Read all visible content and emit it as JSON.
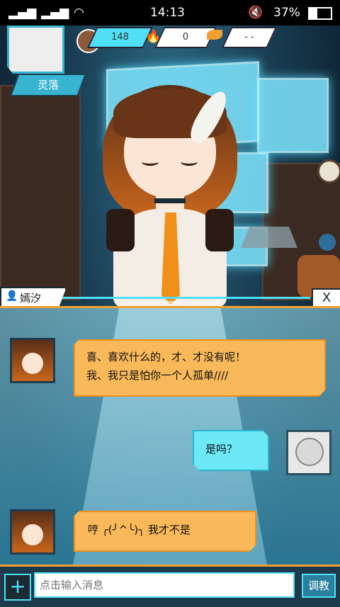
{
  "status_bar": {
    "time": "14:13",
    "battery_percent": "37%",
    "signal_1_label": "1",
    "signal_2_label": "2"
  },
  "hud": {
    "player_name": "灵落",
    "resource_1": "148",
    "resource_2": "0",
    "resource_3": "- -"
  },
  "speaker": {
    "name": "嫣汐",
    "close_label": "X"
  },
  "messages": [
    {
      "sender": "character",
      "text_line_1": "喜、喜欢什么的，才、才没有呢！",
      "text_line_2": "我、我只是怕你一个人孤单////"
    },
    {
      "sender": "player",
      "text_line_1": "是吗？"
    },
    {
      "sender": "character",
      "text_line_1": "哼 ╭(╯^╰)╮ 我才不是"
    }
  ],
  "input": {
    "placeholder": "点击输入消息",
    "action_label": "调教"
  },
  "colors": {
    "accent_orange": "#f0a030",
    "accent_cyan": "#4fe0f5",
    "bubble_orange": "#f9b95a",
    "bubble_cyan": "#6ce8f7"
  }
}
